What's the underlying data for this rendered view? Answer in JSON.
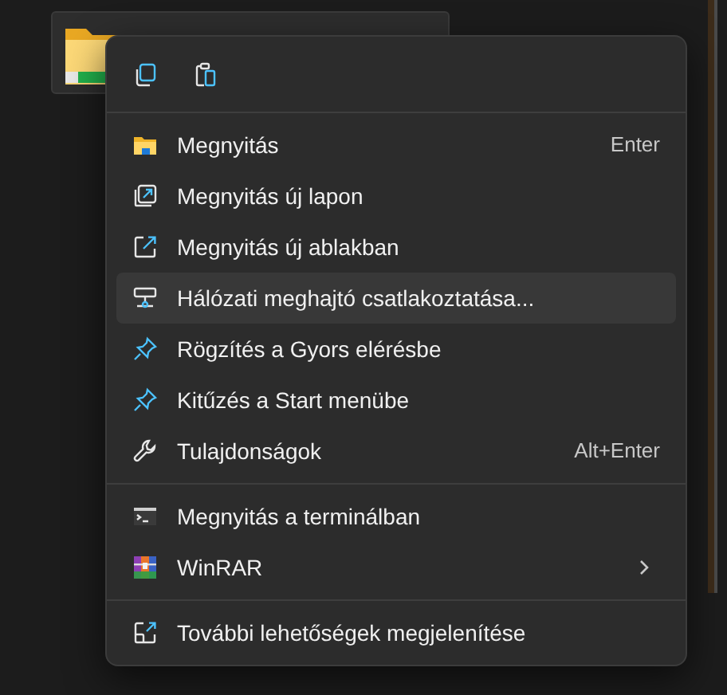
{
  "context_menu": {
    "sections": [
      {
        "items": [
          {
            "label": "Megnyitás",
            "shortcut": "Enter",
            "highlighted": false
          },
          {
            "label": "Megnyitás új lapon",
            "highlighted": false
          },
          {
            "label": "Megnyitás új ablakban",
            "highlighted": false
          },
          {
            "label": "Hálózati meghajtó csatlakoztatása...",
            "highlighted": true
          },
          {
            "label": "Rögzítés a Gyors elérésbe",
            "highlighted": false
          },
          {
            "label": "Kitűzés a Start menübe",
            "highlighted": false
          },
          {
            "label": "Tulajdonságok",
            "shortcut": "Alt+Enter",
            "highlighted": false
          }
        ]
      },
      {
        "items": [
          {
            "label": "Megnyitás a terminálban",
            "highlighted": false
          },
          {
            "label": "WinRAR",
            "has_submenu": true,
            "highlighted": false
          }
        ]
      },
      {
        "items": [
          {
            "label": "További lehetőségek megjelenítése",
            "highlighted": false
          }
        ]
      }
    ]
  }
}
